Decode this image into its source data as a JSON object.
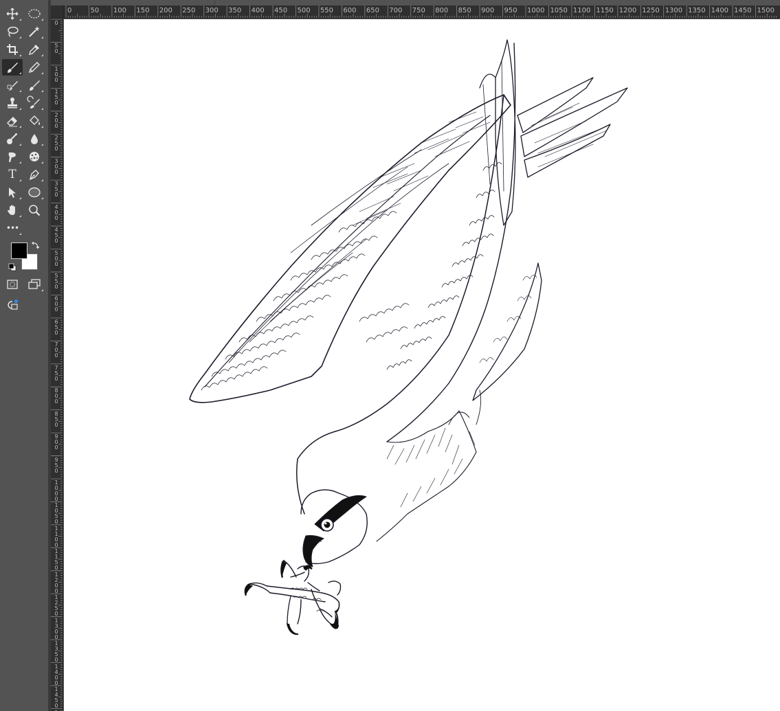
{
  "toolbar": {
    "tools": [
      {
        "id": "move",
        "icon": "move-icon",
        "column": 0,
        "row": 0
      },
      {
        "id": "elliptical-marquee",
        "icon": "elliptical-marquee-icon",
        "column": 1,
        "row": 0
      },
      {
        "id": "lasso",
        "icon": "lasso-icon",
        "column": 0,
        "row": 1
      },
      {
        "id": "magic-wand",
        "icon": "magic-wand-icon",
        "column": 1,
        "row": 1
      },
      {
        "id": "crop",
        "icon": "crop-icon",
        "column": 0,
        "row": 2
      },
      {
        "id": "eyedropper",
        "icon": "eyedropper-icon",
        "column": 1,
        "row": 2
      },
      {
        "id": "brush",
        "icon": "brush-icon",
        "column": 0,
        "row": 3,
        "active": true
      },
      {
        "id": "pencil",
        "icon": "pencil-icon",
        "column": 1,
        "row": 3
      },
      {
        "id": "clone-stamp-source",
        "icon": "spot-healing-icon",
        "column": 0,
        "row": 4
      },
      {
        "id": "mixer-brush",
        "icon": "mixer-brush-icon",
        "column": 1,
        "row": 4
      },
      {
        "id": "clone-stamp",
        "icon": "clone-stamp-icon",
        "column": 0,
        "row": 5
      },
      {
        "id": "history-brush",
        "icon": "history-brush-icon",
        "column": 1,
        "row": 5
      },
      {
        "id": "eraser",
        "icon": "eraser-icon",
        "column": 0,
        "row": 6
      },
      {
        "id": "paint-bucket",
        "icon": "paint-bucket-icon",
        "column": 1,
        "row": 6
      },
      {
        "id": "blur",
        "icon": "dodge-icon",
        "column": 0,
        "row": 7
      },
      {
        "id": "drop",
        "icon": "blur-drop-icon",
        "column": 1,
        "row": 7
      },
      {
        "id": "smudge",
        "icon": "smudge-icon",
        "column": 0,
        "row": 8
      },
      {
        "id": "sponge",
        "icon": "sponge-icon",
        "column": 1,
        "row": 8
      },
      {
        "id": "type",
        "icon": "type-icon",
        "column": 0,
        "row": 9,
        "glyph": "T"
      },
      {
        "id": "pen",
        "icon": "pen-icon",
        "column": 1,
        "row": 9
      },
      {
        "id": "path-selection",
        "icon": "path-selection-icon",
        "column": 0,
        "row": 10
      },
      {
        "id": "ellipse-shape",
        "icon": "ellipse-shape-icon",
        "column": 1,
        "row": 10
      },
      {
        "id": "hand",
        "icon": "hand-icon",
        "column": 0,
        "row": 11
      },
      {
        "id": "zoom",
        "icon": "zoom-icon",
        "column": 1,
        "row": 11
      },
      {
        "id": "more",
        "icon": "more-tools-icon",
        "column": 0,
        "row": 12,
        "glyph": "•••"
      }
    ],
    "foreground_color": "#000000",
    "background_color": "#ffffff"
  },
  "rulers": {
    "horizontal_labels": [
      "0",
      "50",
      "100",
      "150",
      "200",
      "250",
      "300",
      "350",
      "400",
      "450",
      "500",
      "550",
      "600",
      "650",
      "700",
      "750",
      "800",
      "850",
      "900",
      "950",
      "1000",
      "1050",
      "1100",
      "1150",
      "1200",
      "1250",
      "1300",
      "1350",
      "1400",
      "1450",
      "1500"
    ],
    "vertical_labels": [
      "0",
      "50",
      "100",
      "150",
      "200",
      "250",
      "300",
      "350",
      "400",
      "450",
      "500",
      "550",
      "600",
      "650",
      "700",
      "750",
      "800",
      "850",
      "900",
      "950",
      "1000",
      "1050",
      "1100",
      "1150",
      "1200",
      "1250",
      "1300",
      "1350",
      "1400",
      "1450",
      "1500"
    ]
  },
  "canvas": {
    "background": "#ffffff",
    "artwork_stroke": "#1a1a2a",
    "artwork_subject": "osprey line-art sketch"
  }
}
